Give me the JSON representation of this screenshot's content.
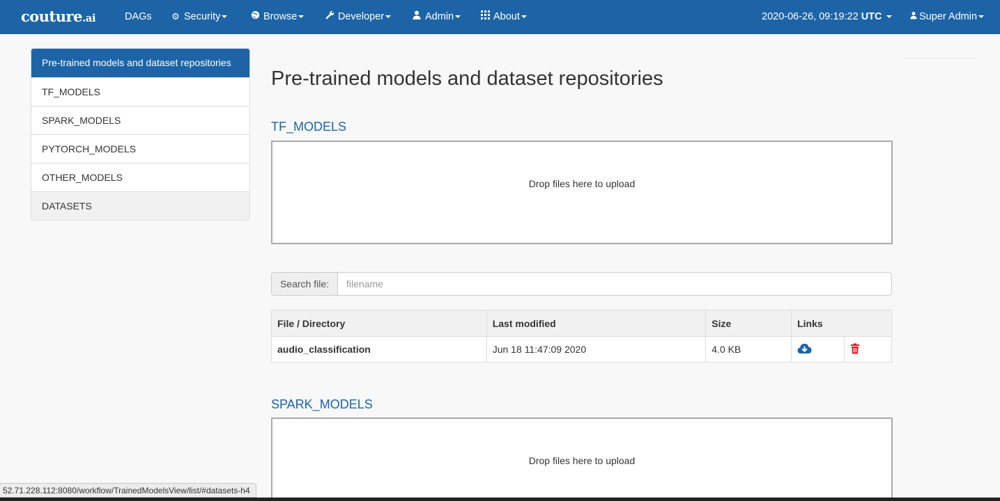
{
  "nav": {
    "brand": "couture",
    "brand_suffix": ".ai",
    "items": [
      {
        "label": "DAGs"
      },
      {
        "label": "Security"
      },
      {
        "label": "Browse"
      },
      {
        "label": "Developer"
      },
      {
        "label": "Admin"
      },
      {
        "label": "About"
      }
    ],
    "datetime": "2020-06-26, 09:19:22",
    "timezone": "UTC",
    "user": "Super Admin"
  },
  "sidebar": {
    "items": [
      {
        "label": "Pre-trained models and dataset repositories"
      },
      {
        "label": "TF_MODELS"
      },
      {
        "label": "SPARK_MODELS"
      },
      {
        "label": "PYTORCH_MODELS"
      },
      {
        "label": "OTHER_MODELS"
      },
      {
        "label": "DATASETS"
      }
    ]
  },
  "main": {
    "title": "Pre-trained models and dataset repositories",
    "sections": [
      {
        "heading": "TF_MODELS",
        "dropzone": "Drop files here to upload"
      },
      {
        "heading": "SPARK_MODELS",
        "dropzone": "Drop files here to upload"
      }
    ],
    "search": {
      "label": "Search file:",
      "placeholder": "filename"
    },
    "table": {
      "headers": [
        "File / Directory",
        "Last modified",
        "Size",
        "Links"
      ],
      "rows": [
        {
          "name": "audio_classification",
          "modified": "Jun 18 11:47:09 2020",
          "size": "4.0 KB"
        }
      ]
    }
  },
  "status_url": "52.71.228.112:8080/workflow/TrainedModelsView/list/#datasets-h4",
  "colors": {
    "primary": "#1c64a6",
    "danger": "#e0141e"
  }
}
